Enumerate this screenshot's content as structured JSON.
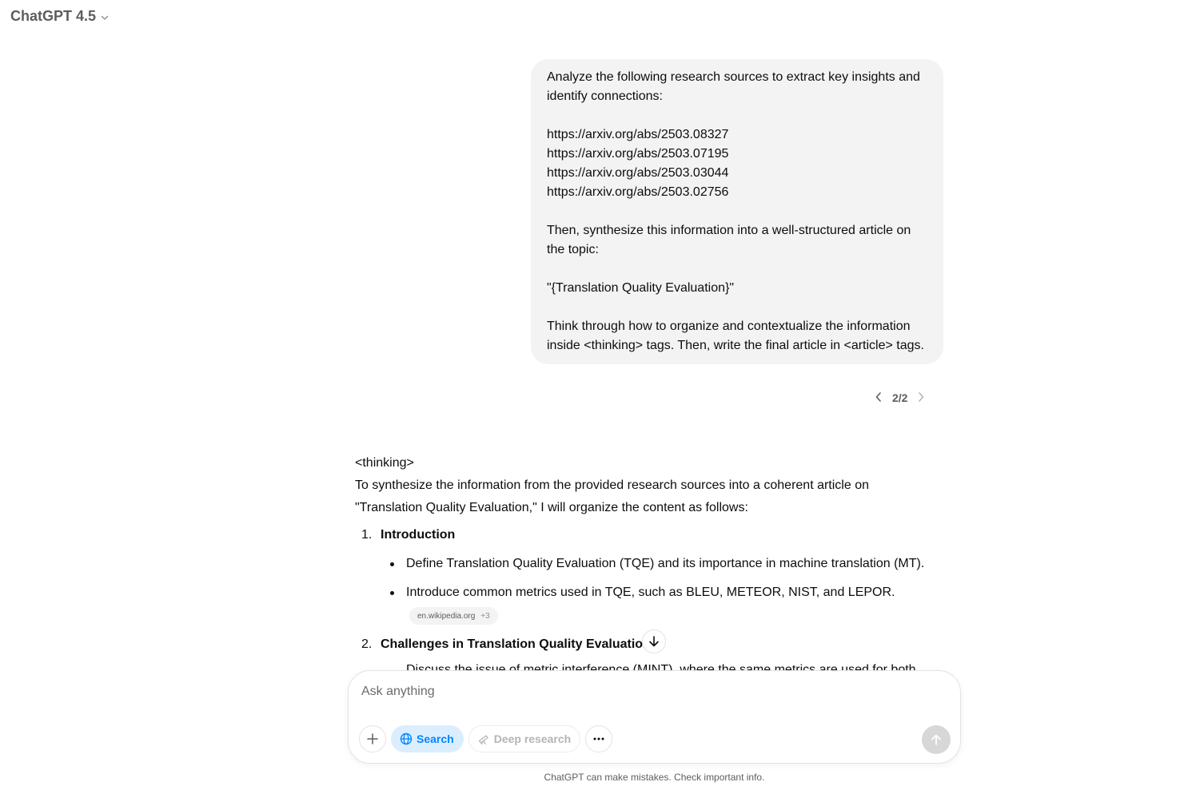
{
  "header": {
    "model_name": "ChatGPT 4.5"
  },
  "user_message": {
    "paragraphs": [
      "Analyze the following research sources to extract key insights and identify connections:",
      "",
      "https://arxiv.org/abs/2503.08327",
      "https://arxiv.org/abs/2503.07195",
      "https://arxiv.org/abs/2503.03044",
      "https://arxiv.org/abs/2503.02756",
      "",
      "Then, synthesize this information into a well-structured article on the topic:",
      "",
      "\"{Translation Quality Evaluation}\"",
      "",
      "Think through how to organize and contextualize the information inside <thinking> tags. Then, write the final article in <article> tags."
    ]
  },
  "pager": {
    "label": "2/2"
  },
  "assistant": {
    "open_tag": "<thinking>",
    "intro_line1": "To synthesize the information from the provided research sources into a coherent article on",
    "intro_line2": "\"Translation Quality Evaluation,\" I will organize the content as follows:",
    "sections": [
      {
        "number": "1.",
        "title": "Introduction",
        "bullets": [
          "Define Translation Quality Evaluation (TQE) and its importance in machine translation (MT).",
          "Introduce common metrics used in TQE, such as BLEU, METEOR, NIST, and LEPOR."
        ],
        "citation": {
          "source": "en.wikipedia.org",
          "extra": "+3"
        }
      },
      {
        "number": "2.",
        "title": "Challenges in Translation Quality Evaluation"
      }
    ],
    "peek_text": "Discuss the issue of metric interference (MINT), where the same metrics are used for both"
  },
  "composer": {
    "placeholder": "Ask anything",
    "value": "",
    "search_label": "Search",
    "deep_research_label": "Deep research"
  },
  "footer": {
    "disclaimer": "ChatGPT can make mistakes. Check important info."
  },
  "colors": {
    "bubble_bg": "#f3f3f3",
    "search_accent": "#0285ff",
    "search_bg": "#dbeeff",
    "send_disabled": "#d7d7d7"
  }
}
